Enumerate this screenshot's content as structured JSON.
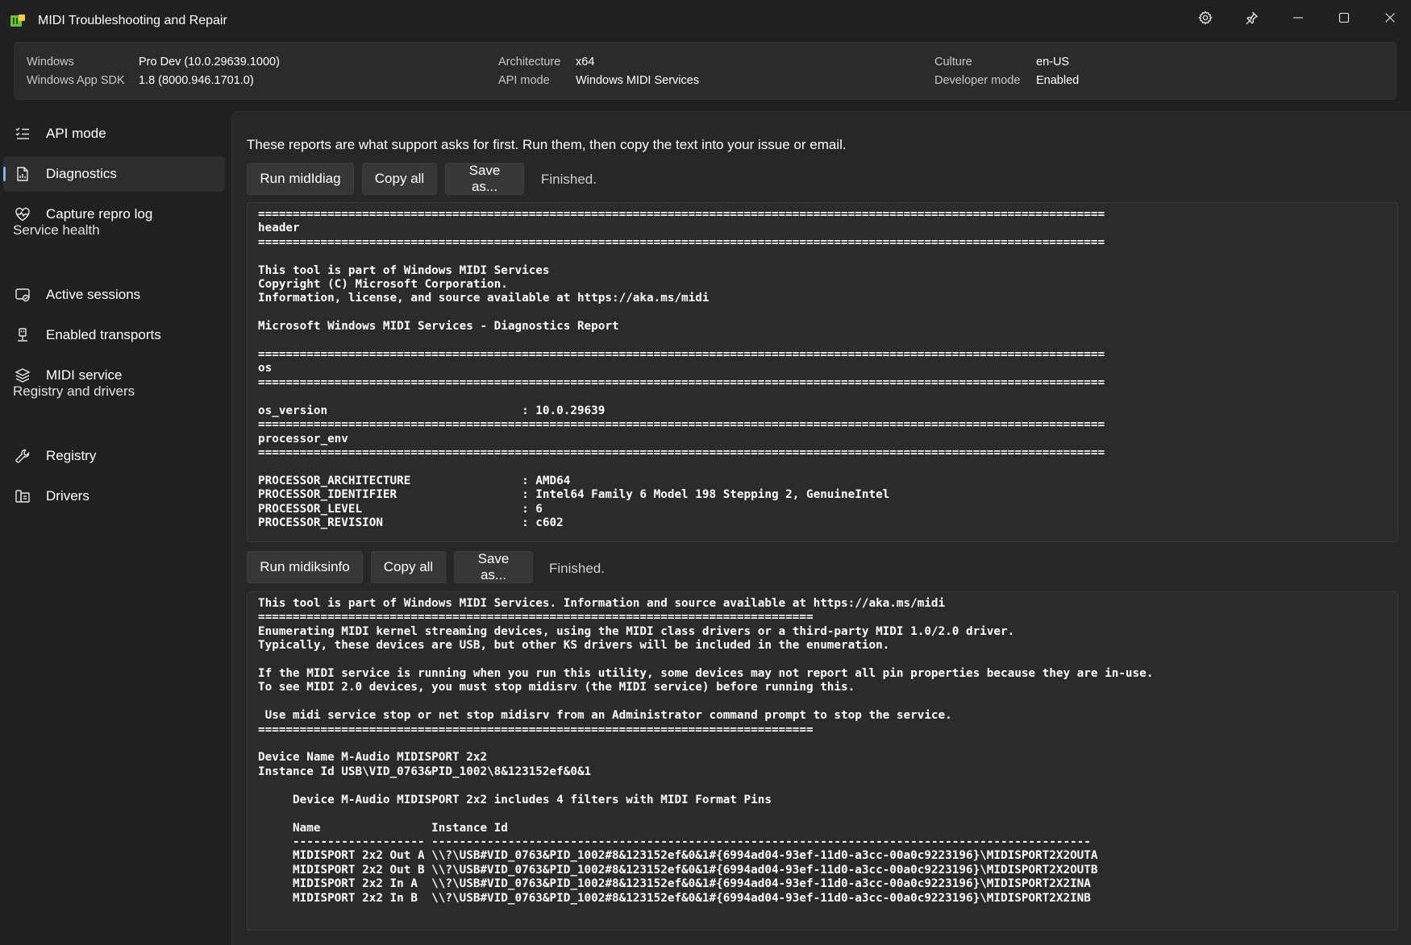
{
  "window": {
    "title": "MIDI Troubleshooting and Repair"
  },
  "info": {
    "windows_label": "Windows",
    "windows_value": "Pro Dev (10.0.29639.1000)",
    "sdk_label": "Windows App SDK",
    "sdk_value": "1.8 (8000.946.1701.0)",
    "arch_label": "Architecture",
    "arch_value": "x64",
    "apimode_label": "API mode",
    "apimode_value": "Windows MIDI Services",
    "culture_label": "Culture",
    "culture_value": "en-US",
    "devmode_label": "Developer mode",
    "devmode_value": "Enabled"
  },
  "sidebar": {
    "items": [
      {
        "label": "API mode",
        "icon": "checklist-icon"
      },
      {
        "label": "Diagnostics",
        "icon": "report-icon"
      },
      {
        "label": "Capture repro log",
        "icon": "heart-pulse-icon"
      }
    ],
    "section_service": "Service health",
    "service_items": [
      {
        "label": "Active sessions",
        "icon": "sessions-icon"
      },
      {
        "label": "Enabled transports",
        "icon": "usb-icon"
      },
      {
        "label": "MIDI service",
        "icon": "layers-icon"
      }
    ],
    "section_registry": "Registry and drivers",
    "registry_items": [
      {
        "label": "Registry",
        "icon": "wrench-icon"
      },
      {
        "label": "Drivers",
        "icon": "drivers-icon"
      }
    ]
  },
  "main": {
    "intro": "These reports are what support asks for first. Run them, then copy the text into your issue or email.",
    "section1": {
      "run_label": "Run midIdiag",
      "copy_label": "Copy all",
      "save_label": "Save as...",
      "status": "Finished.",
      "output": "==========================================================================================================================\nheader\n==========================================================================================================================\n\nThis tool is part of Windows MIDI Services\nCopyright (C) Microsoft Corporation.\nInformation, license, and source available at https://aka.ms/midi\n\nMicrosoft Windows MIDI Services - Diagnostics Report\n\n==========================================================================================================================\nos\n==========================================================================================================================\n\nos_version                            : 10.0.29639\n==========================================================================================================================\nprocessor_env\n==========================================================================================================================\n\nPROCESSOR_ARCHITECTURE                : AMD64\nPROCESSOR_IDENTIFIER                  : Intel64 Family 6 Model 198 Stepping 2, GenuineIntel\nPROCESSOR_LEVEL                       : 6\nPROCESSOR_REVISION                    : c602"
    },
    "section2": {
      "run_label": "Run midiksinfo",
      "copy_label": "Copy all",
      "save_label": "Save as...",
      "status": "Finished.",
      "output": "This tool is part of Windows MIDI Services. Information and source available at https://aka.ms/midi\n================================================================================\nEnumerating MIDI kernel streaming devices, using the MIDI class drivers or a third-party MIDI 1.0/2.0 driver.\nTypically, these devices are USB, but other KS drivers will be included in the enumeration.\n\nIf the MIDI service is running when you run this utility, some devices may not report all pin properties because they are in-use.\nTo see MIDI 2.0 devices, you must stop midisrv (the MIDI service) before running this.\n\n Use midi service stop or net stop midisrv from an Administrator command prompt to stop the service.\n================================================================================\n\nDevice Name M-Audio MIDISPORT 2x2\nInstance Id USB\\VID_0763&PID_1002\\8&123152ef&0&1\n\n     Device M-Audio MIDISPORT 2x2 includes 4 filters with MIDI Format Pins\n\n     Name                Instance Id\n     ------------------- -----------------------------------------------------------------------------------------------\n     MIDISPORT 2x2 Out A \\\\?\\USB#VID_0763&PID_1002#8&123152ef&0&1#{6994ad04-93ef-11d0-a3cc-00a0c9223196}\\MIDISPORT2X2OUTA\n     MIDISPORT 2x2 Out B \\\\?\\USB#VID_0763&PID_1002#8&123152ef&0&1#{6994ad04-93ef-11d0-a3cc-00a0c9223196}\\MIDISPORT2X2OUTB\n     MIDISPORT 2x2 In A  \\\\?\\USB#VID_0763&PID_1002#8&123152ef&0&1#{6994ad04-93ef-11d0-a3cc-00a0c9223196}\\MIDISPORT2X2INA\n     MIDISPORT 2x2 In B  \\\\?\\USB#VID_0763&PID_1002#8&123152ef&0&1#{6994ad04-93ef-11d0-a3cc-00a0c9223196}\\MIDISPORT2X2INB"
    }
  },
  "colors": {
    "background": "#202020",
    "panel": "#2b2b2b",
    "accent": "#76b9ed"
  }
}
